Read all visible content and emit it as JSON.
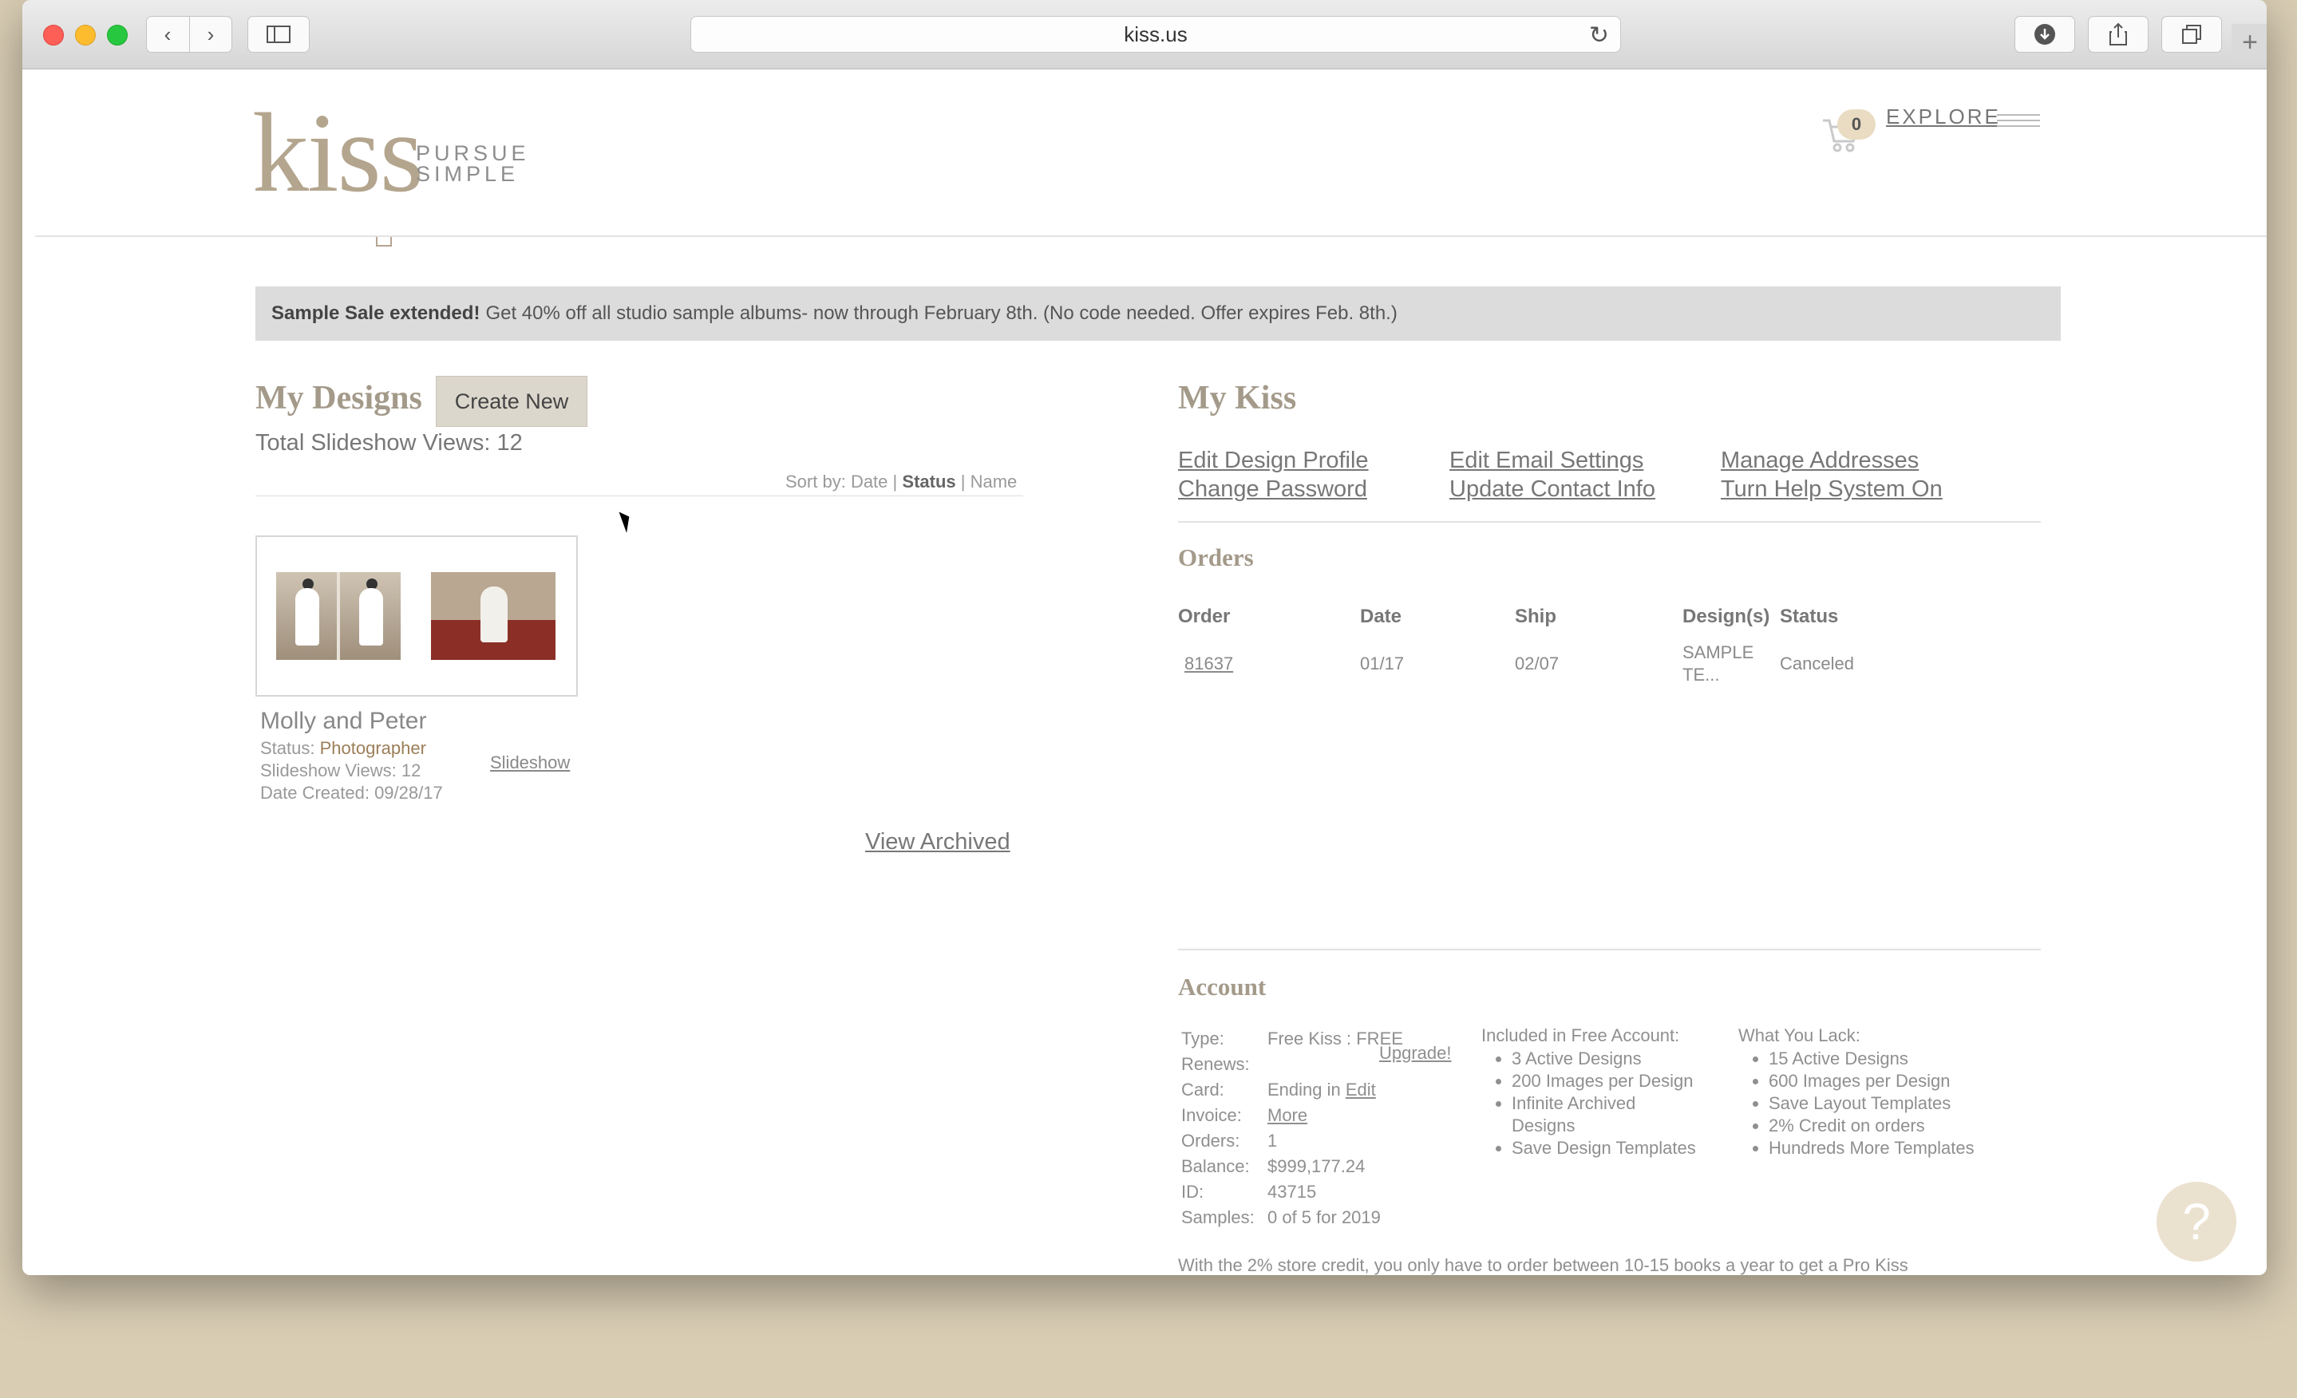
{
  "browser": {
    "url": "kiss.us",
    "back_label": "‹",
    "forward_label": "›"
  },
  "header": {
    "logo_text": "kiss",
    "logo_sub_1": "PURSUE",
    "logo_sub_2": "SIMPLE",
    "cart_count": "0",
    "explore_label": "EXPLORE"
  },
  "banner": {
    "bold": "Sample Sale extended!",
    "text": "Get 40% off all studio sample albums- now through February 8th. (No code needed. Offer expires Feb. 8th.)"
  },
  "designs": {
    "title": "My Designs",
    "create_label": "Create New",
    "total_views": "Total Slideshow Views: 12",
    "sort_prefix": "Sort by:",
    "sort_date": "Date",
    "sort_sep1": "|",
    "sort_status": "Status",
    "sort_sep2": "|",
    "sort_name": "Name",
    "card": {
      "name": "Molly and Peter",
      "status_label": "Status:",
      "status_value": "Photographer",
      "views": "Slideshow Views: 12",
      "date_created": "Date Created: 09/28/17",
      "slideshow_label": "Slideshow"
    },
    "view_archived": "View Archived"
  },
  "mykiss": {
    "title": "My Kiss",
    "links": {
      "edit_design_profile": "Edit Design Profile",
      "change_password": "Change Password",
      "edit_email_settings": "Edit Email Settings",
      "update_contact_info": "Update Contact Info",
      "manage_addresses": "Manage Addresses",
      "turn_help_on": "Turn Help System On"
    }
  },
  "orders": {
    "title": "Orders",
    "columns": [
      "Order",
      "Date",
      "Ship",
      "Design(s)",
      "Status"
    ],
    "rows": [
      {
        "order": "81637",
        "date": "01/17",
        "ship": "02/07",
        "design_1": "SAMPLE",
        "design_2": "TE...",
        "status": "Canceled"
      }
    ]
  },
  "account": {
    "title": "Account",
    "type_label": "Type:",
    "type_value": "Free Kiss : FREE",
    "upgrade_label": "Upgrade!",
    "renews_label": "Renews:",
    "card_label": "Card:",
    "card_value": "Ending in",
    "card_edit": "Edit",
    "invoice_label": "Invoice:",
    "invoice_value": "More",
    "orders_label": "Orders:",
    "orders_value": "1",
    "balance_label": "Balance:",
    "balance_value": "$999,177.24",
    "id_label": "ID:",
    "id_value": "43715",
    "samples_label": "Samples:",
    "samples_value": "0 of 5 for 2019",
    "included_title": "Included in Free Account:",
    "included": [
      "3 Active Designs",
      "200 Images per Design",
      "Infinite Archived Designs",
      "Save Design Templates"
    ],
    "lack_title": "What You Lack:",
    "lack": [
      "15 Active Designs",
      "600 Images per Design",
      "Save Layout Templates",
      "2% Credit on orders",
      "Hundreds More Templates"
    ],
    "footnote": "With the 2% store credit, you only have to order between 10-15 books a year to get a Pro Kiss"
  },
  "help": {
    "label": "?"
  }
}
